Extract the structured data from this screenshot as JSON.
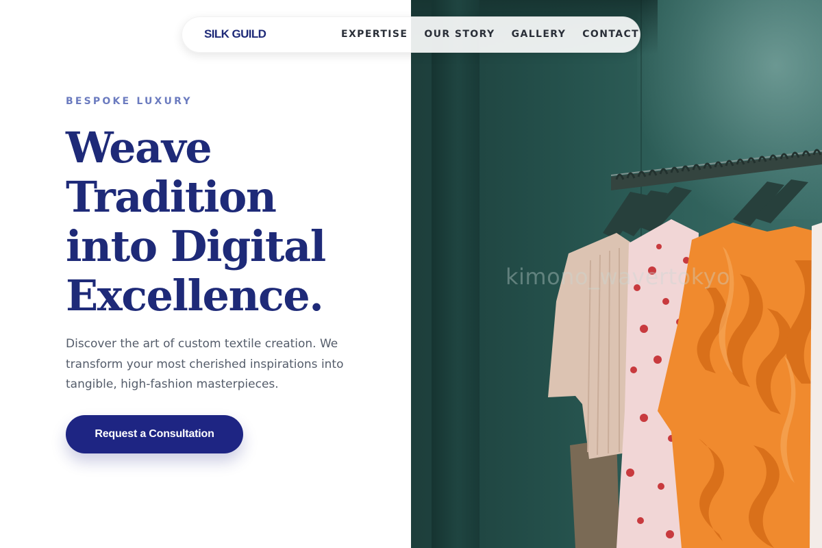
{
  "brand": "SILK GUILD",
  "nav": {
    "links": [
      {
        "label": "EXPERTISE"
      },
      {
        "label": "OUR STORY"
      },
      {
        "label": "GALLERY"
      },
      {
        "label": "CONTACT"
      }
    ]
  },
  "hero": {
    "eyebrow": "BESPOKE LUXURY",
    "headline_lines": [
      "Weave",
      "Tradition",
      "into Digital",
      "Excellence."
    ],
    "lead": "Discover the art of custom textile creation. We transform your most cherished inspirations into tangible, high-fashion masterpieces.",
    "cta_label": "Request a Consultation"
  },
  "photo": {
    "watermark": "kimono_wavertokyo"
  },
  "colors": {
    "primary": "#1e2a78",
    "button": "#1e2583",
    "eyebrow": "#6b7bbf",
    "body_text": "#545c6a",
    "photo_wall": "#2e5f59",
    "orange_garment": "#f08a2e"
  }
}
